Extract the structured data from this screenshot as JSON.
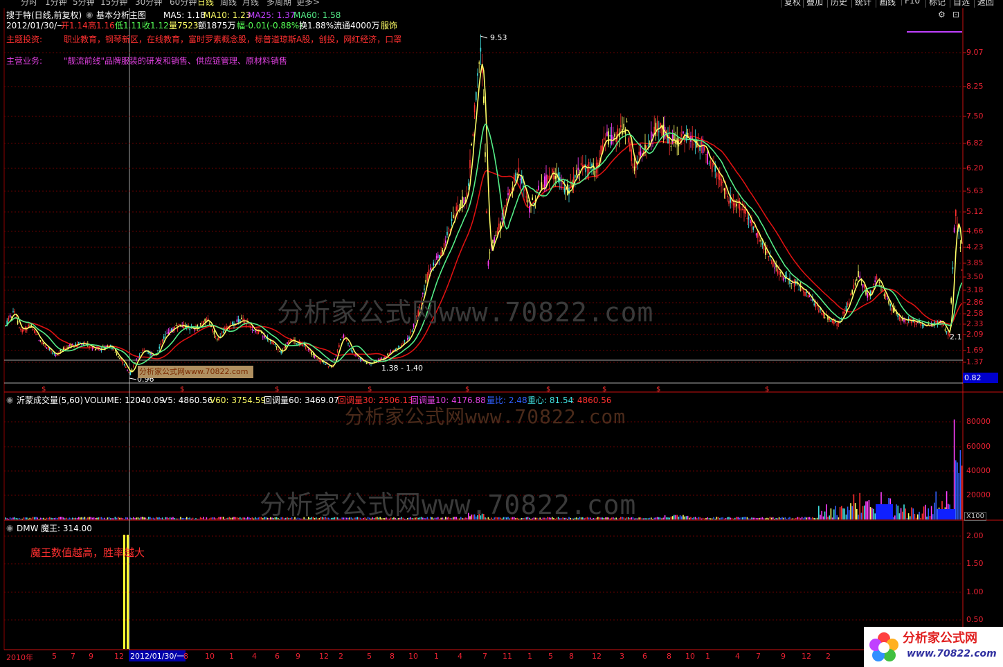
{
  "top_menu": {
    "left_tabs": [
      "分时",
      "1分钟",
      "5分钟",
      "15分钟",
      "30分钟",
      "60分钟",
      "日线",
      "周线",
      "月线",
      "多周期",
      "更多>"
    ],
    "right_buttons": [
      "复权",
      "叠加",
      "历史",
      "统计",
      "画线",
      "F10",
      "标记",
      "自选",
      "返回"
    ]
  },
  "header": {
    "stock": "搜于特(日线,前复权)",
    "template": "基本分析主图",
    "ma5": "MA5: 1.18",
    "ma10": "MA10: 1.23",
    "ma25": "MA25: 1.37",
    "ma60": "MA60: 1.58",
    "date": "2012/01/30/一",
    "open": "开1.14",
    "high": "高1.16",
    "low": "低1.11",
    "close": "收1.12",
    "volume": "量7523",
    "amount": "额1875万",
    "change": "幅-0.01(-0.88%)",
    "turnover": "换1.88%",
    "float": "流通4000万",
    "industry": "服饰"
  },
  "info": {
    "theme_label": "主题投资:",
    "theme_text": "职业教育，钢琴新区，在线教育，富时罗素概念股，标普道琼斯A股，创投，网红经济，口罩",
    "business_label": "主营业务:",
    "business_text": "\"靓流前线\"品牌服装的研发和销售、供应链管理、原材料销售"
  },
  "annotations": {
    "peak": "9.53",
    "low_label": "0.96",
    "range_label": "1.38 - 1.40",
    "recent_low": "2.1",
    "watermark_box": "分析家公式网www.70822.com",
    "current_price": "0.82",
    "dollar_mark": "$"
  },
  "price_axis": [
    "9.07",
    "8.25",
    "7.50",
    "6.82",
    "6.20",
    "5.63",
    "5.12",
    "4.66",
    "4.23",
    "3.85",
    "3.50",
    "3.18",
    "2.86",
    "2.58",
    "2.33",
    "2.09",
    "1.69",
    "1.37"
  ],
  "volume_header": {
    "name": "沂蒙成交量(5,60)",
    "volume": "VOLUME: 12040.09",
    "v5": "V5: 4860.56",
    "v60": "V60: 3754.59",
    "hdl60": "回调量60: 3469.07",
    "hdl30": "回调量30: 2506.13",
    "hdl10": "回调量10: 4176.88",
    "liangbi": "量比: 2.48",
    "zhongxin": "重心: 81.54",
    "last": ": 4860.56"
  },
  "volume_axis": [
    "80000",
    "60000",
    "40000",
    "20000"
  ],
  "volume_unit": "X100",
  "dmw_header": {
    "name": "DMW",
    "value": "魔王: 314.00"
  },
  "dmw_note": "魔王数值越高，胜率越大",
  "dmw_axis": [
    "2.00",
    "1.50",
    "1.00",
    "0.50"
  ],
  "time_axis": {
    "year": "2010年",
    "labels": [
      "5",
      "7",
      "9",
      "12",
      "8",
      "10",
      "1",
      "4",
      "6",
      "9",
      "12",
      "2",
      "5",
      "8",
      "10",
      "1",
      "4",
      "7",
      "11",
      "1",
      "5",
      "8",
      "12",
      "3",
      "6",
      "8",
      "10",
      "1",
      "4",
      "7",
      "9",
      "12",
      "2"
    ],
    "cursor_date": "2012/01/30/一"
  },
  "watermarks": [
    "分析家公式网www.70822.com",
    "分析家公式网www.70822.com",
    "分析家公式网www.70822.com"
  ],
  "logo": {
    "name": "分析家公式网",
    "url": "www.70822.com"
  },
  "colors": {
    "up": "#ff3030",
    "down": "#40e0e0",
    "ma_short": "#ffff66",
    "ma_long": "#dd1111",
    "ma_mid": "#55ee88",
    "grid": "#8b0000"
  }
}
